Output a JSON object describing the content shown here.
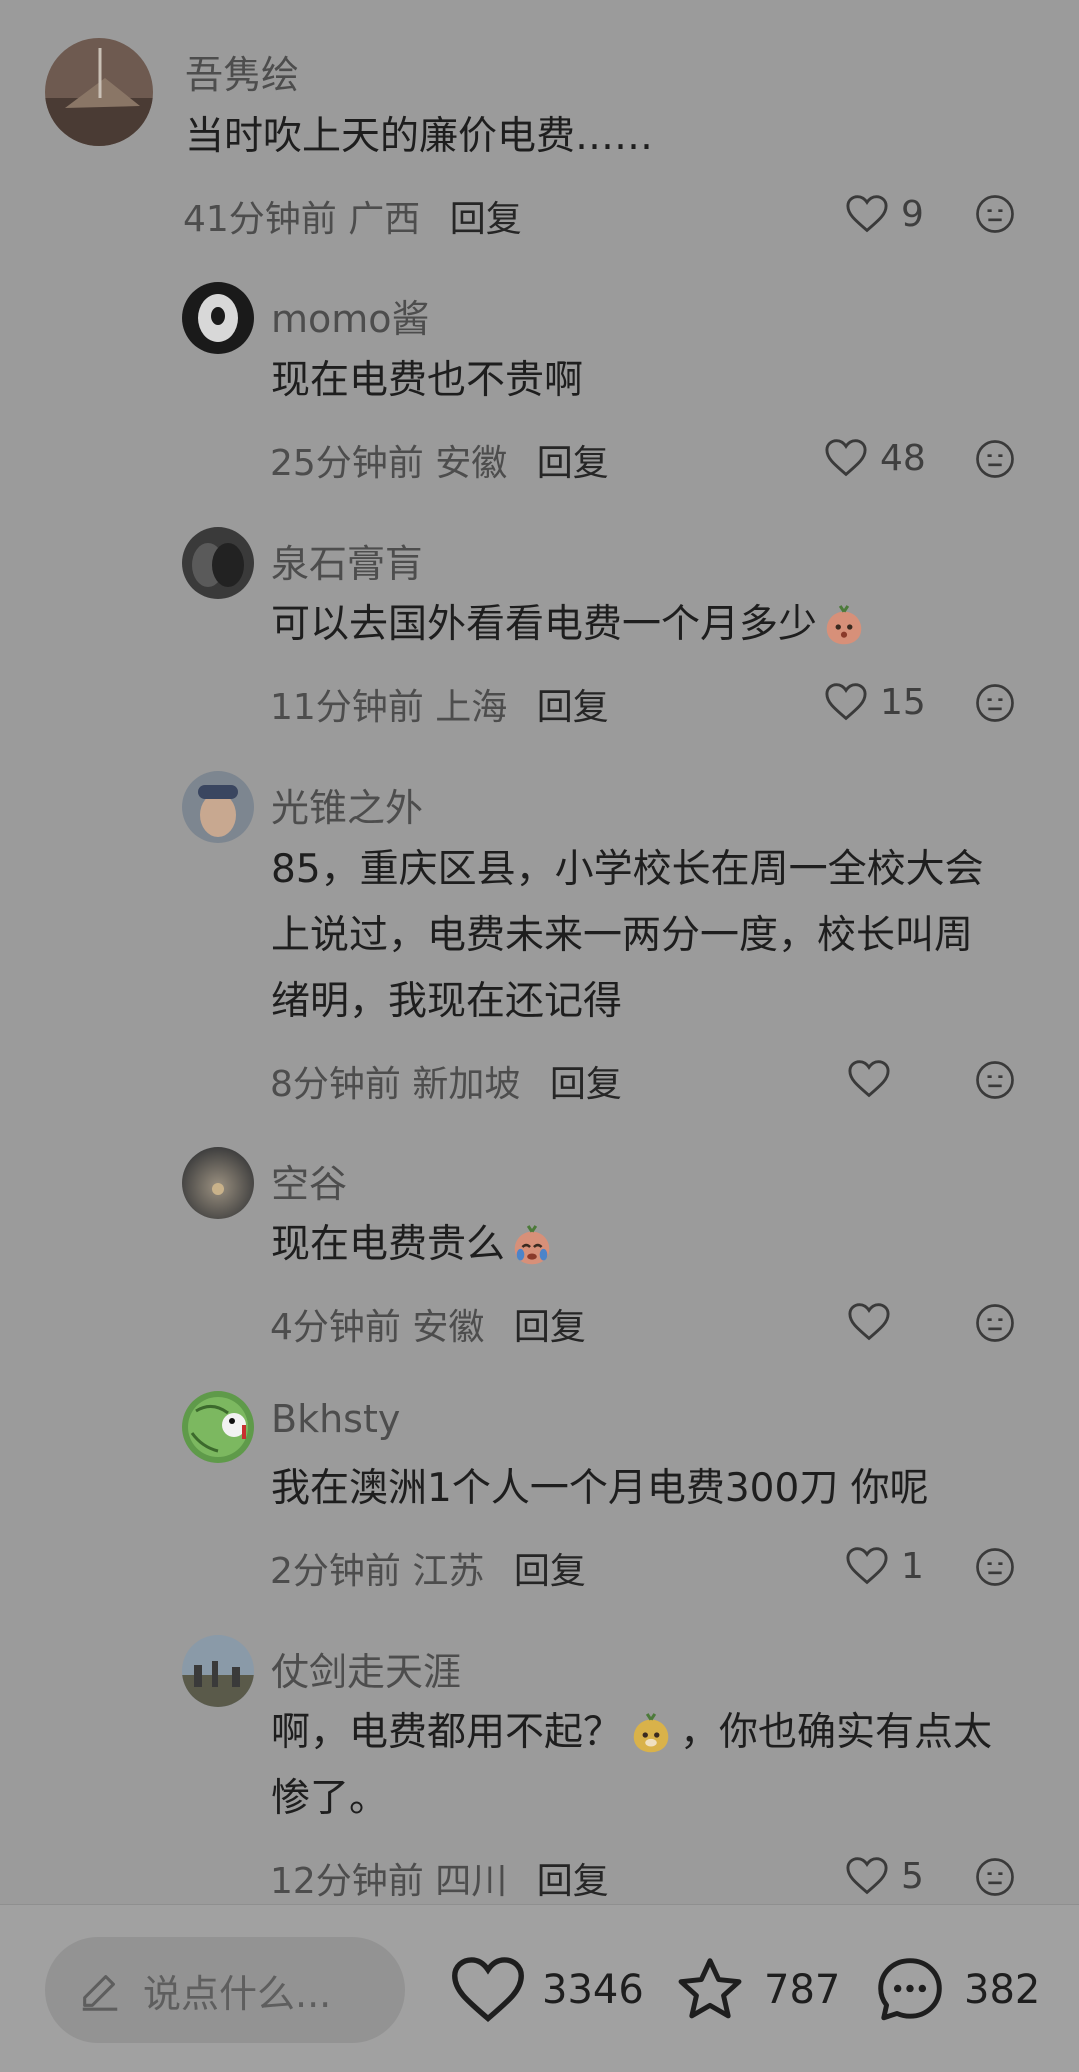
{
  "comments": [
    {
      "author": "吾隽绘",
      "text": "当时吹上天的廉价电费……",
      "time": "41分钟前",
      "location": "广西",
      "reply": "回复",
      "likes": "9"
    },
    {
      "author": "momo酱",
      "text": "现在电费也不贵啊",
      "time": "25分钟前",
      "location": "安徽",
      "reply": "回复",
      "likes": "48"
    },
    {
      "author": "泉石膏肓",
      "text": "可以去国外看看电费一个月多少",
      "time": "11分钟前",
      "location": "上海",
      "reply": "回复",
      "likes": "15"
    },
    {
      "author": "光锥之外",
      "text_lines": [
        "85，重庆区县，小学校长在周一全校大会",
        "上说过，电费未来一两分一度，校长叫周",
        "绪明，我现在还记得"
      ],
      "time": "8分钟前",
      "location": "新加坡",
      "reply": "回复",
      "likes": ""
    },
    {
      "author": "空谷",
      "text": "现在电费贵么",
      "time": "4分钟前",
      "location": "安徽",
      "reply": "回复",
      "likes": ""
    },
    {
      "author": "Bkhsty",
      "text": "我在澳洲1个人一个月电费300刀 你呢",
      "time": "2分钟前",
      "location": "江苏",
      "reply": "回复",
      "likes": "1"
    },
    {
      "author": "仗剑走天涯",
      "text_part1": "啊，电费都用不起？",
      "text_part2": "，你也确实有点太",
      "text_line2": "惨了。",
      "time": "12分钟前",
      "location": "四川",
      "reply": "回复",
      "likes": "5"
    }
  ],
  "bottom_bar": {
    "input_placeholder": "说点什么...",
    "likes": "3346",
    "favorites": "787",
    "comments": "382"
  },
  "icons": {
    "like": "heart-icon",
    "dislike": "unhappy-face-icon",
    "edit": "pencil-icon",
    "star": "star-icon",
    "comment": "chat-bubble-icon"
  }
}
